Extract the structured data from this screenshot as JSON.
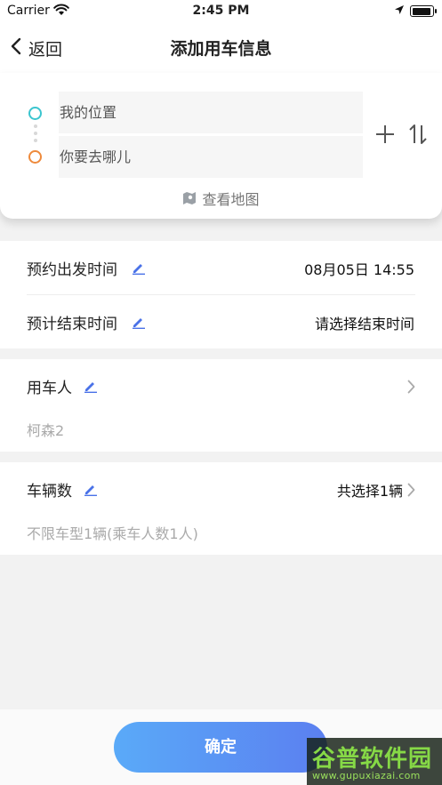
{
  "status_bar": {
    "carrier": "Carrier",
    "time": "2:45 PM"
  },
  "nav": {
    "back_label": "返回",
    "title": "添加用车信息"
  },
  "route": {
    "from_placeholder": "我的位置",
    "to_placeholder": "你要去哪儿",
    "map_link": "查看地图"
  },
  "time_section": {
    "departure_label": "预约出发时间",
    "departure_value": "08月05日 14:55",
    "end_label": "预计结束时间",
    "end_value": "请选择结束时间"
  },
  "rider_section": {
    "label": "用车人",
    "value": "柯森2"
  },
  "vehicle_section": {
    "label": "车辆数",
    "value": "共选择1辆",
    "detail": "不限车型1辆(乘车人数1人)"
  },
  "footer": {
    "confirm_label": "确定"
  },
  "watermark": {
    "title": "谷普软件园",
    "url": "www.gupuxiazai.com"
  },
  "colors": {
    "start_dot": "#3bc5cf",
    "end_dot": "#ee8a3c",
    "edit_icon": "#4a72e8",
    "button_gradient_start": "#5aaaf8",
    "button_gradient_end": "#5b7ff0"
  },
  "icons": [
    "wifi-icon",
    "location-arrow-icon",
    "battery-icon",
    "chevron-left-icon",
    "plus-icon",
    "swap-icon",
    "map-icon",
    "pencil-icon",
    "chevron-right-icon"
  ]
}
